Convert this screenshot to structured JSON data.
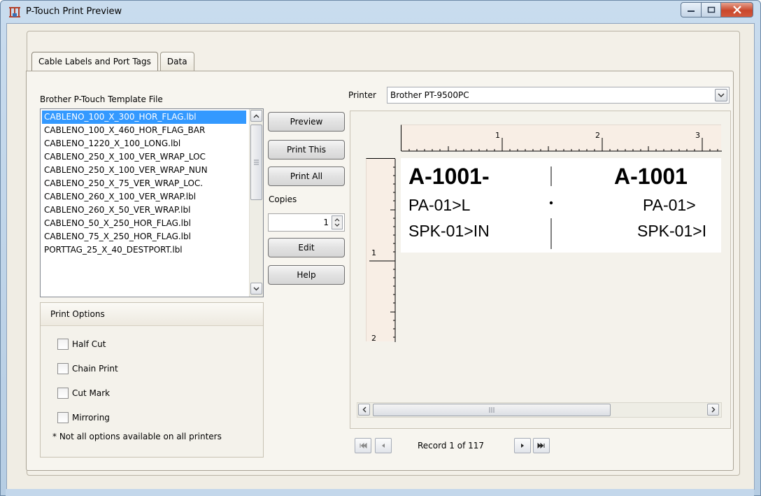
{
  "window": {
    "title": "P-Touch Print Preview",
    "icon": "ptouch-app-icon",
    "accent": "#c9472c"
  },
  "tabs": [
    {
      "label": "Cable Labels and Port Tags",
      "active": true
    },
    {
      "label": "Data",
      "active": false
    }
  ],
  "template": {
    "label": "Brother P-Touch Template File",
    "files": [
      "CABLENO_100_X_300_HOR_FLAG.lbl",
      "CABLENO_100_X_460_HOR_FLAG_BAR",
      "CABLENO_1220_X_100_LONG.lbl",
      "CABLENO_250_X_100_VER_WRAP_LOC",
      "CABLENO_250_X_100_VER_WRAP_NUN",
      "CABLENO_250_X_75_VER_WRAP_LOC.",
      "CABLENO_260_X_100_VER_WRAP.lbl",
      "CABLENO_260_X_50_VER_WRAP.lbl",
      "CABLENO_50_X_250_HOR_FLAG.lbl",
      "CABLENO_75_X_250_HOR_FLAG.lbl",
      "PORTTAG_25_X_40_DESTPORT.lbl"
    ],
    "selected_index": 0
  },
  "actions": {
    "preview": "Preview",
    "print_this": "Print This",
    "print_all": "Print All",
    "copies_label": "Copies",
    "copies_value": "1",
    "edit": "Edit",
    "help": "Help"
  },
  "print_options": {
    "title": "Print Options",
    "items": [
      {
        "label": "Half Cut",
        "checked": false
      },
      {
        "label": "Chain Print",
        "checked": false
      },
      {
        "label": "Cut Mark",
        "checked": false
      },
      {
        "label": "Mirroring",
        "checked": false
      }
    ],
    "note": "* Not all options available on all printers"
  },
  "printer": {
    "label": "Printer",
    "value": "Brother PT-9500PC"
  },
  "ruler": {
    "h_marks": [
      "1",
      "2",
      "3"
    ],
    "v_marks": [
      "1",
      "2"
    ]
  },
  "label_preview": {
    "left": {
      "line1": "A-1001-",
      "line2": "PA-01>L",
      "line3": "SPK-01>IN"
    },
    "right": {
      "line1": "A-1001",
      "line2": "PA-01>",
      "line3": "SPK-01>I"
    }
  },
  "record_nav": {
    "text": "Record 1 of 117"
  }
}
